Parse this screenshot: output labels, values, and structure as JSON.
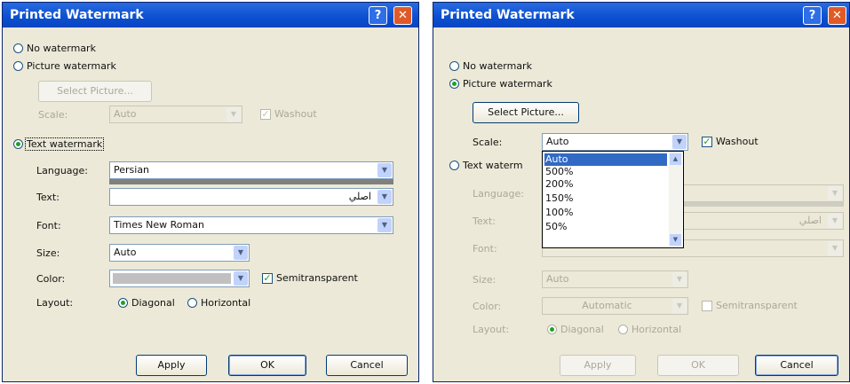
{
  "left": {
    "title": "Printed Watermark",
    "no_watermark": "No watermark",
    "picture_watermark": "Picture watermark",
    "select_picture": "Select Picture...",
    "scale_label": "Scale:",
    "scale_value": "Auto",
    "washout": "Washout",
    "text_watermark": "Text watermark",
    "language_label": "Language:",
    "language_value": "Persian",
    "text_label": "Text:",
    "text_value": "اصلي",
    "font_label": "Font:",
    "font_value": "Times New Roman",
    "size_label": "Size:",
    "size_value": "Auto",
    "color_label": "Color:",
    "semitransparent": "Semitransparent",
    "layout_label": "Layout:",
    "diagonal": "Diagonal",
    "horizontal": "Horizontal",
    "apply": "Apply",
    "ok": "OK",
    "cancel": "Cancel"
  },
  "right": {
    "title": "Printed Watermark",
    "no_watermark": "No watermark",
    "picture_watermark": "Picture watermark",
    "select_picture": "Select Picture...",
    "scale_label": "Scale:",
    "scale_value": "Auto",
    "washout": "Washout",
    "text_watermark": "Text waterm",
    "scale_options": [
      "Auto",
      "500%",
      "200%",
      "150%",
      "100%",
      "50%"
    ],
    "language_label": "Language:",
    "text_label": "Text:",
    "text_value": "اصلي",
    "font_label": "Font:",
    "size_label": "Size:",
    "size_value": "Auto",
    "color_label": "Color:",
    "color_value": "Automatic",
    "semitransparent": "Semitransparent",
    "layout_label": "Layout:",
    "diagonal": "Diagonal",
    "horizontal": "Horizontal",
    "apply": "Apply",
    "ok": "OK",
    "cancel": "Cancel"
  },
  "colors": {
    "title_bar": "#0b4fd0",
    "dialog_bg": "#ece9d8",
    "selection": "#316ac5",
    "close_button": "#e05a28"
  }
}
